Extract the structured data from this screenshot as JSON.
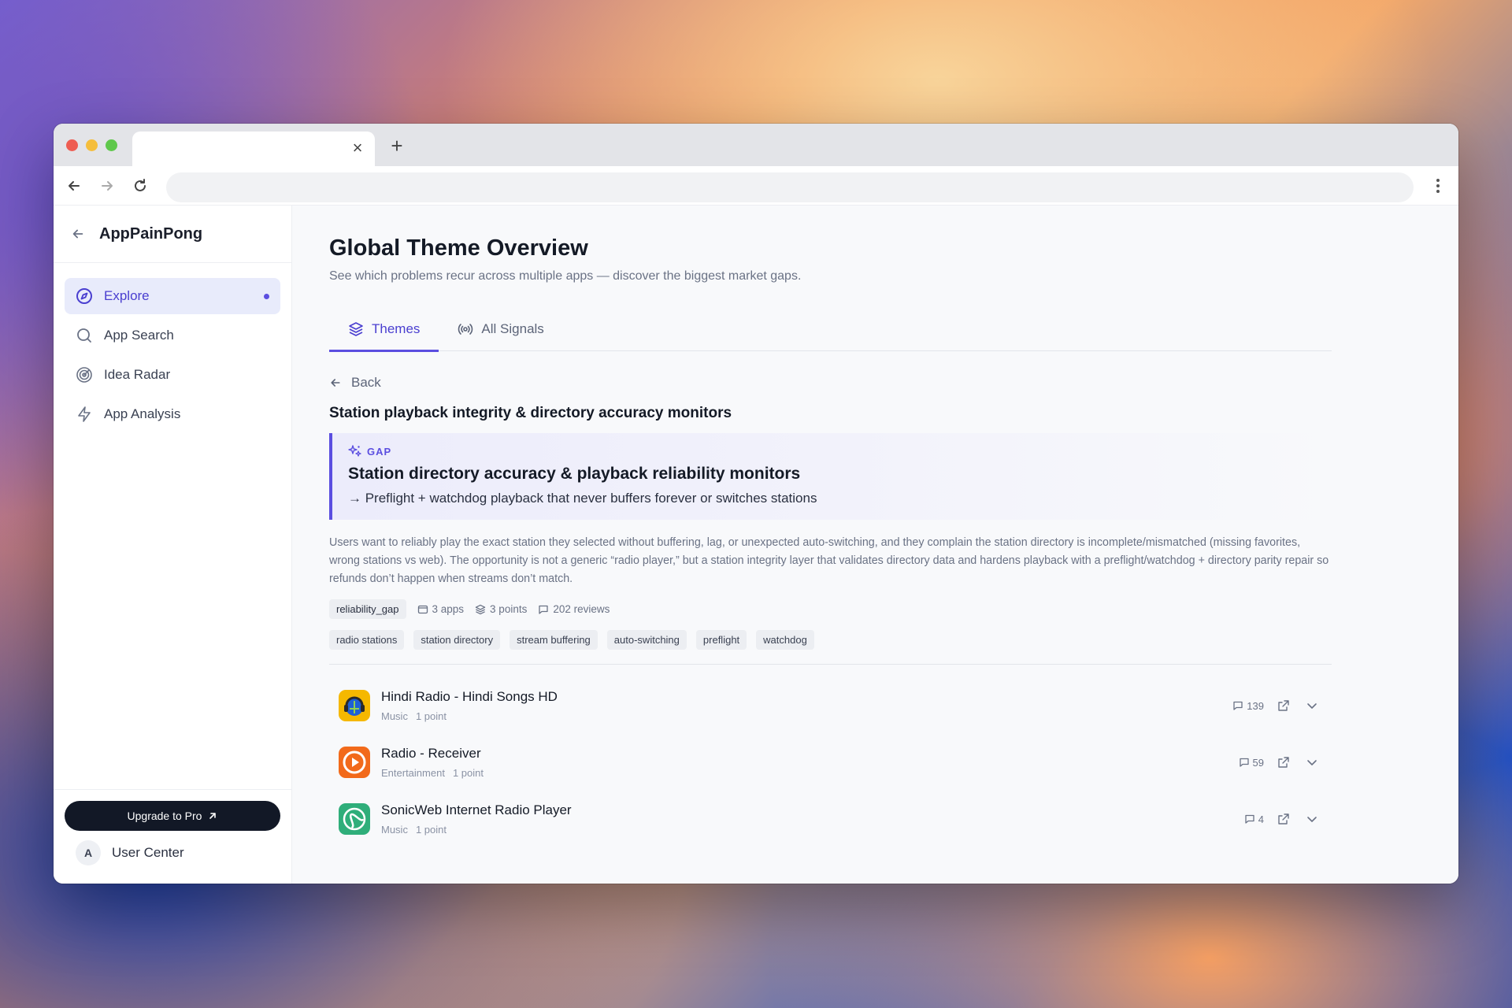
{
  "browser": {
    "tab_title": "",
    "url": "",
    "close_glyph": "×",
    "new_tab_glyph": "+"
  },
  "sidebar": {
    "brand": "AppPainPong",
    "items": [
      {
        "label": "Explore",
        "icon": "compass-icon",
        "active": true
      },
      {
        "label": "App Search",
        "icon": "search-icon"
      },
      {
        "label": "Idea Radar",
        "icon": "radar-icon"
      },
      {
        "label": "App Analysis",
        "icon": "lightning-icon"
      }
    ],
    "upgrade_label": "Upgrade to Pro",
    "user_initial": "A",
    "user_label": "User Center"
  },
  "header": {
    "title": "Global Theme Overview",
    "subtitle": "See which problems recur across multiple apps — discover the biggest market gaps."
  },
  "tabs": [
    {
      "label": "Themes",
      "icon": "layers-icon",
      "active": true
    },
    {
      "label": "All Signals",
      "icon": "broadcast-icon"
    }
  ],
  "detail": {
    "back_label": "Back",
    "theme_title": "Station playback integrity & directory accuracy monitors",
    "gap": {
      "tag": "GAP",
      "title": "Station directory accuracy & playback reliability monitors",
      "subtitle": "→ Preflight + watchdog playback that never buffers forever or switches stations"
    },
    "description": "Users want to reliably play the exact station they selected without buffering, lag, or unexpected auto-switching, and they complain the station directory is incomplete/mismatched (missing favorites, wrong stations vs web). The opportunity is not a generic “radio player,” but a station integrity layer that validates directory data and hardens playback with a preflight/watchdog + directory parity repair so refunds don’t happen when streams don’t match.",
    "category_chip": "reliability_gap",
    "apps_count": "3 apps",
    "points_count": "3 points",
    "reviews_count": "202 reviews",
    "tags": [
      "radio stations",
      "station directory",
      "stream buffering",
      "auto-switching",
      "preflight",
      "watchdog"
    ]
  },
  "apps": [
    {
      "name": "Hindi Radio - Hindi Songs HD",
      "category": "Music",
      "points": "1 point",
      "reviews": "139",
      "icon_color": "#f5b800"
    },
    {
      "name": "Radio - Receiver",
      "category": "Entertainment",
      "points": "1 point",
      "reviews": "59",
      "icon_color": "#f26a1b"
    },
    {
      "name": "SonicWeb Internet Radio Player",
      "category": "Music",
      "points": "1 point",
      "reviews": "4",
      "icon_color": "#2fae7a"
    }
  ],
  "colors": {
    "accent": "#5b4ee0",
    "active_bg": "#e8ebfb",
    "upgrade_bg": "#121826"
  }
}
